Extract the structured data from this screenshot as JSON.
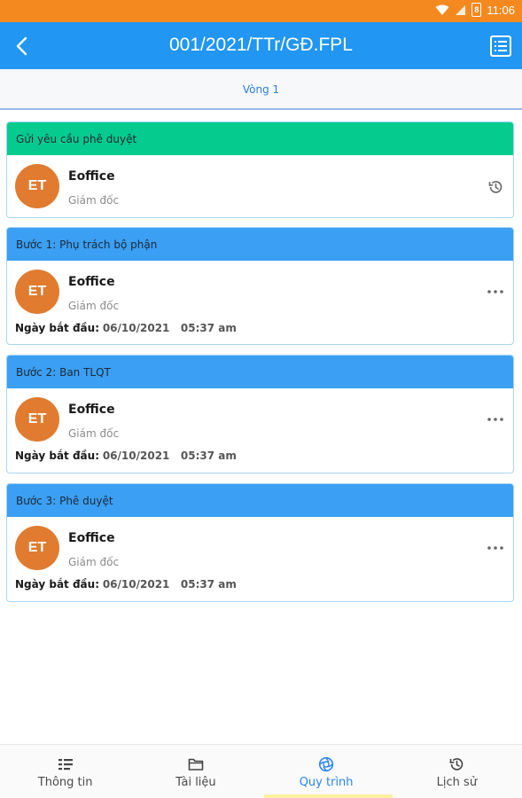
{
  "status_bar": {
    "time": "11:06",
    "battery_level": "8"
  },
  "header": {
    "title": "001/2021/TTr/GĐ.FPL"
  },
  "round": {
    "label": "Vòng 1"
  },
  "steps": [
    {
      "title": "Gửi yêu cầu phê duyệt",
      "color": "#05cb8e",
      "avatar": "ET",
      "name": "Eoffice",
      "role": "Giám đốc",
      "action_icon": "history-icon"
    },
    {
      "title": "Bước 1: Phụ trách bộ phận",
      "color": "#3b9ff3",
      "avatar": "ET",
      "name": "Eoffice",
      "role": "Giám đốc",
      "start_label": "Ngày bắt đầu:",
      "start_value": "06/10/2021   05:37 am",
      "action_icon": "more-icon"
    },
    {
      "title": "Bước 2: Ban TLQT",
      "color": "#3b9ff3",
      "avatar": "ET",
      "name": "Eoffice",
      "role": "Giám đốc",
      "start_label": "Ngày bắt đầu:",
      "start_value": "06/10/2021   05:37 am",
      "action_icon": "more-icon"
    },
    {
      "title": "Bước 3: Phê duyệt",
      "color": "#3b9ff3",
      "avatar": "ET",
      "name": "Eoffice",
      "role": "Giám đốc",
      "start_label": "Ngày bắt đầu:",
      "start_value": "06/10/2021   05:37 am",
      "action_icon": "more-icon"
    }
  ],
  "bottom_nav": {
    "items": [
      {
        "label": "Thông tin",
        "icon": "info-list-icon"
      },
      {
        "label": "Tài liệu",
        "icon": "folder-icon"
      },
      {
        "label": "Quy trình",
        "icon": "process-icon",
        "active": true
      },
      {
        "label": "Lịch sử",
        "icon": "history-icon"
      }
    ]
  },
  "colors": {
    "status_bar": "#f48a1f",
    "app_bar": "#2196f3",
    "green": "#05cb8e",
    "blue": "#3b9ff3",
    "avatar": "#e07b2f",
    "active": "#2a86f0"
  }
}
